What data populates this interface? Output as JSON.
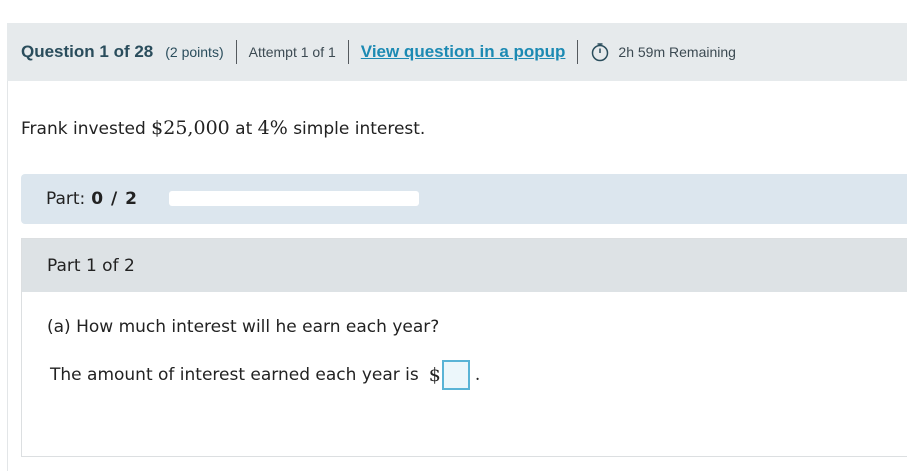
{
  "header": {
    "question_label": "Question 1 of 28",
    "points": "(2 points)",
    "attempt": "Attempt 1 of 1",
    "popup_link": "View question in a popup",
    "time_remaining": "2h 59m Remaining",
    "timer_icon": "stopwatch-icon"
  },
  "problem": {
    "prefix": "Frank invested ",
    "amount": "$25,000",
    "middle": " at ",
    "rate": "4%",
    "suffix": " simple interest."
  },
  "progress": {
    "label": "Part:",
    "count": "0 / 2",
    "fraction_complete": 0
  },
  "part": {
    "header": "Part 1 of 2",
    "question": "(a) How much interest will he earn each year?",
    "answer_prompt": "The amount of interest earned each year is",
    "currency": "$",
    "answer_value": "",
    "trailing": "."
  },
  "colors": {
    "header_bg": "#e6eaec",
    "link": "#1c8ab3",
    "part_bar_bg": "#dce6ee",
    "part_header_bg": "#dde2e5",
    "input_border": "#5ab4d6"
  }
}
